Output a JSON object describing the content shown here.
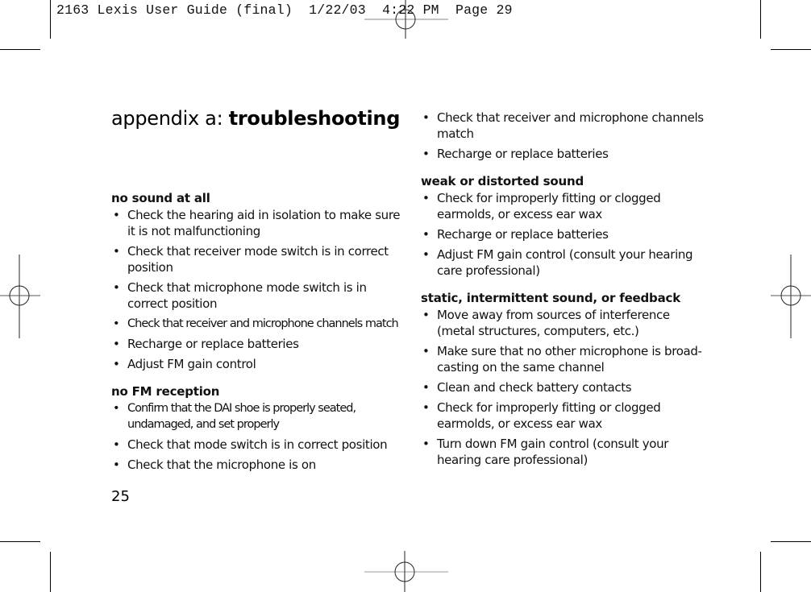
{
  "slug_line": "2163 Lexis User Guide (final)  1/22/03  4:22 PM  Page 29",
  "title": {
    "prefix": "appendix a: ",
    "emphasis": "troubleshooting"
  },
  "page_number": "25",
  "bullet_glyph": "•",
  "left_column": [
    {
      "heading": "no sound at all",
      "items": [
        "Check the hearing aid in isolation to make sure it is not malfunctioning",
        "Check that receiver mode switch is in correct position",
        "Check that microphone mode switch is in correct position",
        "Check that receiver and microphone channels match",
        "Recharge or replace batteries",
        "Adjust FM gain control"
      ]
    },
    {
      "heading": "no FM reception",
      "items": [
        "Confirm that the DAI shoe is properly seated, undamaged, and set properly",
        "Check that mode switch is in correct position",
        "Check that the microphone is on"
      ]
    }
  ],
  "right_column": [
    {
      "heading": "",
      "items": [
        "Check that receiver and microphone channels match",
        "Recharge or replace batteries"
      ]
    },
    {
      "heading": "weak or distorted sound",
      "items": [
        "Check for improperly fitting or clogged earmolds, or excess ear wax",
        "Recharge or replace batteries",
        "Adjust FM gain control (consult your hearing care professional)"
      ]
    },
    {
      "heading": "static, intermittent sound, or feedback",
      "items": [
        "Move away from sources of interference (metal structures, computers, etc.)",
        "Make sure that no other microphone is broad-casting on the same channel",
        "Clean and check battery contacts",
        "Check for improperly fitting or clogged earmolds, or excess ear wax",
        "Turn down FM gain control (consult your hearing care professional)"
      ]
    }
  ]
}
